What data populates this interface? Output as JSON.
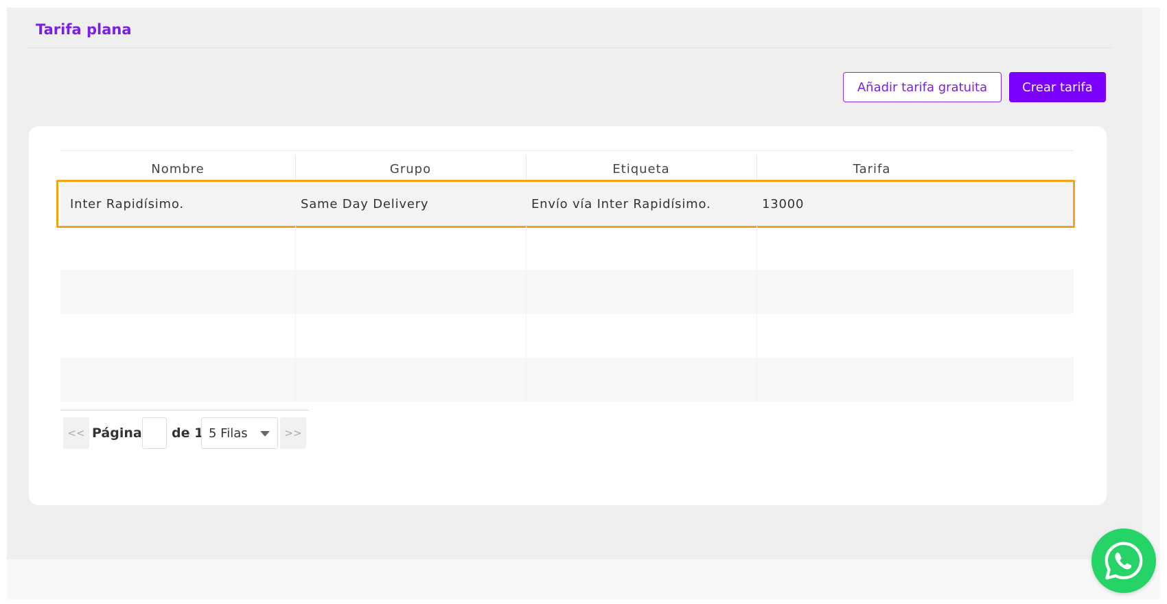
{
  "section": {
    "title": "Tarifa plana"
  },
  "toolbar": {
    "add_free_label": "Añadir tarifa gratuita",
    "create_label": "Crear tarifa"
  },
  "table": {
    "columns": [
      "Nombre",
      "Grupo",
      "Etiqueta",
      "Tarifa"
    ],
    "rows": [
      {
        "nombre": "Inter Rapidísimo.",
        "grupo": "Same Day Delivery",
        "etiqueta": "Envío vía Inter Rapidísimo.",
        "tarifa": "13000"
      }
    ]
  },
  "pagination": {
    "prev": "<<",
    "page_label": "Página",
    "page_value": "",
    "of_label": "de 1",
    "rows_select": "5 Filas",
    "next": ">>"
  },
  "colors": {
    "accent": "#7b00ff",
    "highlight": "#f5a21b",
    "whatsapp": "#25d366"
  },
  "icons": {
    "chat": "whatsapp-icon",
    "select": "chevron-down-icon"
  }
}
